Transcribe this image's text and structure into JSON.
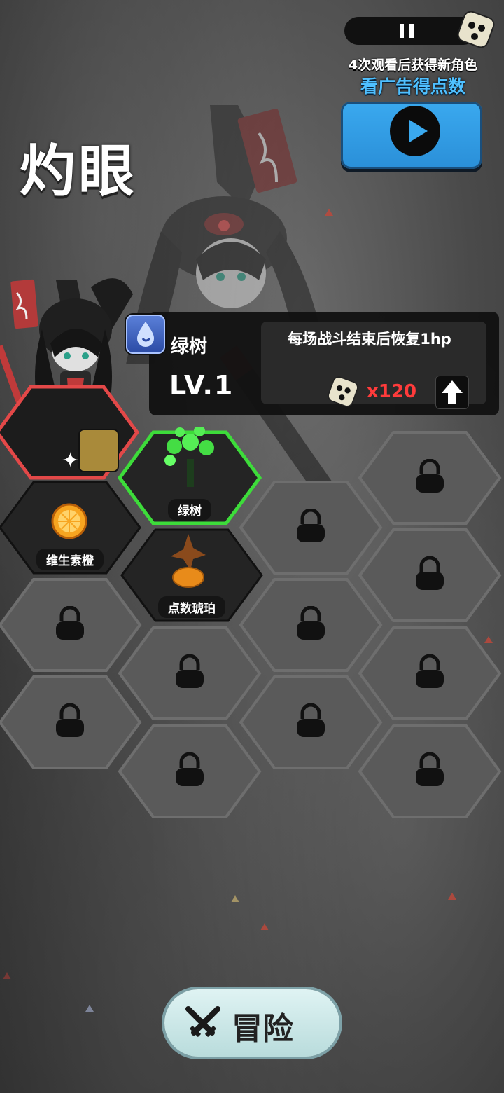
{
  "topbar": {
    "pause_icon": "pause-icon",
    "dice_icon": "dice-icon"
  },
  "ad": {
    "hint": "4次观看后获得新角色",
    "title": "看广告得点数",
    "button_icon": "play-icon"
  },
  "character": {
    "name": "灼眼"
  },
  "info": {
    "item_name": "绿树",
    "level": "LV.1",
    "description": "每场战斗结束后恢复1hp",
    "cost": "x120",
    "upgrade_icon": "arrow-up-icon"
  },
  "slots": {
    "character_portrait": "character-portrait",
    "green_tree_label": "绿树",
    "vitamin_orange_label": "维生素橙",
    "point_amber_label": "点数琥珀",
    "locked_icon": "lock-icon"
  },
  "adventure": {
    "label": "冒险",
    "icon": "crossed-swords-icon"
  },
  "colors": {
    "accent_blue": "#3aa9ef",
    "selected_green": "#3ddc3a",
    "character_red": "#e34848",
    "cost_red": "#ff3b3b"
  }
}
